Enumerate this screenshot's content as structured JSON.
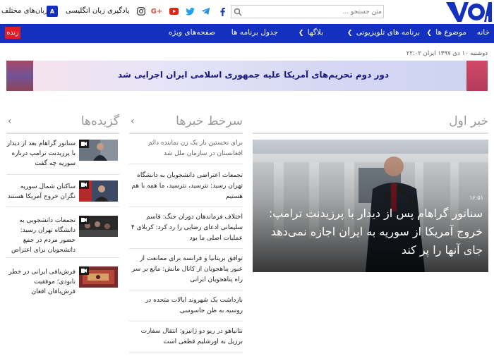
{
  "header": {
    "logo_text": "VOA",
    "search_placeholder": "متن جستجو ...",
    "links": {
      "languages": "زبان‌های مختلف",
      "learn_english": "یادگیری زبان انگلیسی"
    },
    "social_icons": [
      "facebook-icon",
      "telegram-icon",
      "twitter-icon",
      "youtube-icon",
      "google-plus-icon",
      "instagram-icon"
    ]
  },
  "nav": {
    "items": [
      {
        "label": "خانه"
      },
      {
        "label": "موضوع ها"
      },
      {
        "label": "برنامه های تلویزیونی"
      },
      {
        "label": "بلاگها"
      },
      {
        "label": "جدول برنامه ها"
      },
      {
        "label": "صفحه‌های ویژه"
      }
    ],
    "live_label": "زنده"
  },
  "date_line": "دوشنبه ۱۰ دی ۱۳۹۷ ایران ۲۲:۰۲",
  "banner": {
    "text": "دور دوم تحریم‌های آمریکا علیه جمهوری اسلامی ایران اجرایی شد"
  },
  "columns": {
    "top_news_title": "خبر اول",
    "headlines_title": "سرخط خبرها",
    "featured_title": "گزیده‌ها"
  },
  "hero": {
    "time": "۱۶:۵۱",
    "title": "سناتور گراهام پس از دیدار با پرزیدنت ترامپ: خروج آمریکا از سوریه به ایران اجازه نمی‌دهد جای آنها را پر کند"
  },
  "headlines": [
    "برای نخستین بار یک زن نماینده دائم افغانستان در سازمان ملل شد",
    "تجمعات اعتراضی دانشجویان به دانشگاه تهران رسید: نترسید، نترسید، ما همه با هم هستیم",
    "اختلاف فرماندهان دوران جنگ: قاسم سلیمانی ادعای رضایی را رد کرد: کربلای ۴ عملیات اصلی ما بود",
    "توافق بریتانیا و فرانسه برای ممانعت از عبور پناهجویان از کانال مانش: مانع بر سر راه پناهجویان ایرانی",
    "بازداشت یک شهروند ایالات متحده در روسیه به ظن جاسوسی",
    "نتانیاهو در ریو دو ژانیرو: انتقال سفارت برزیل به اورشلیم قطعی است"
  ],
  "featured": [
    "سناتور گراهام بعد از دیدار با پرزیدنت ترامپ درباره سوریه چه گفت",
    "ساکنان شمال سوریه نگران خروج آمریکا هستند",
    "تجمعات دانشجویی به دانشگاه تهران رسید: حضور مردم در جمع دانشجویان برای اعتراض",
    "فرش‌بافی ایرانی در خطر نابودی؛ موفقیت فرش‌بافان افغان"
  ],
  "colors": {
    "nav_bg": "#1330bf",
    "live_bg": "#e31b23",
    "logo_blue": "#1330bf"
  }
}
